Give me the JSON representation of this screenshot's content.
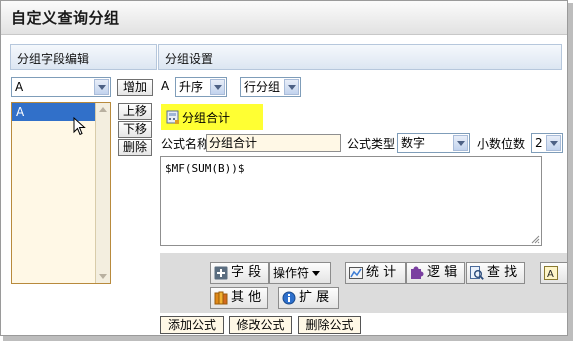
{
  "window": {
    "title": "自定义查询分组"
  },
  "left_panel": {
    "header": "分组字段编辑",
    "field_select": "A",
    "add_button": "增加",
    "list_items": [
      "A"
    ],
    "move_up": "上移",
    "move_down": "下移",
    "delete": "删除"
  },
  "right_panel": {
    "header": "分组设置",
    "field_name": "A",
    "order_select": "升序",
    "group_type_select": "行分组",
    "subtotal_label": "分组合计",
    "formula_name_label": "公式名称",
    "formula_name_value": "分组合计",
    "formula_type_label": "公式类型",
    "formula_type_value": "数字",
    "decimals_label": "小数位数",
    "decimals_value": "2",
    "formula_text": "$MF(SUM(B))$"
  },
  "toolbar": {
    "field_btn": "字 段",
    "operator_btn": "操作符",
    "stats_btn": "统 计",
    "logic_btn": "逻 辑",
    "find_btn": "查 找",
    "other_btn": "其 他",
    "extend_btn": "扩 展"
  },
  "actions": {
    "add_formula": "添加公式",
    "edit_formula": "修改公式",
    "delete_formula": "删除公式"
  }
}
